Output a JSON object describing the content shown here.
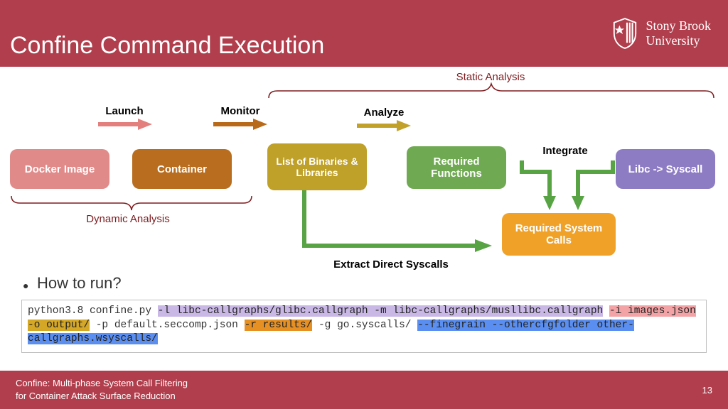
{
  "header": {
    "title": "Confine Command Execution",
    "logo_line1": "Stony Brook",
    "logo_line2": "University"
  },
  "diagram": {
    "top_brace_label": "Static Analysis",
    "bottom_brace_label": "Dynamic Analysis",
    "arrows": {
      "launch": "Launch",
      "monitor": "Monitor",
      "analyze": "Analyze",
      "integrate": "Integrate",
      "extract": "Extract Direct Syscalls"
    },
    "blocks": {
      "docker": "Docker Image",
      "container": "Container",
      "list": "List of Binaries & Libraries",
      "reqfn": "Required Functions",
      "libc": "Libc -> Syscall",
      "reqsys": "Required System Calls"
    }
  },
  "howto": "How to run?",
  "code": {
    "pre1": "python3.8 confine.py ",
    "purple": "-l libc-callgraphs/glibc.callgraph -m libc-callgraphs/musllibc.callgraph",
    "pink": "-i images.json",
    "mustard": "-o output/",
    "plain1": " -p default.seccomp.json ",
    "orange": "-r results/",
    "plain2": " -g go.syscalls/ ",
    "blue": "--finegrain --othercfgfolder other-callgraphs.wsyscalls/"
  },
  "footer": {
    "line1": "Confine: Multi-phase System Call Filtering",
    "line2": "for Container Attack Surface Reduction",
    "page": "13"
  }
}
